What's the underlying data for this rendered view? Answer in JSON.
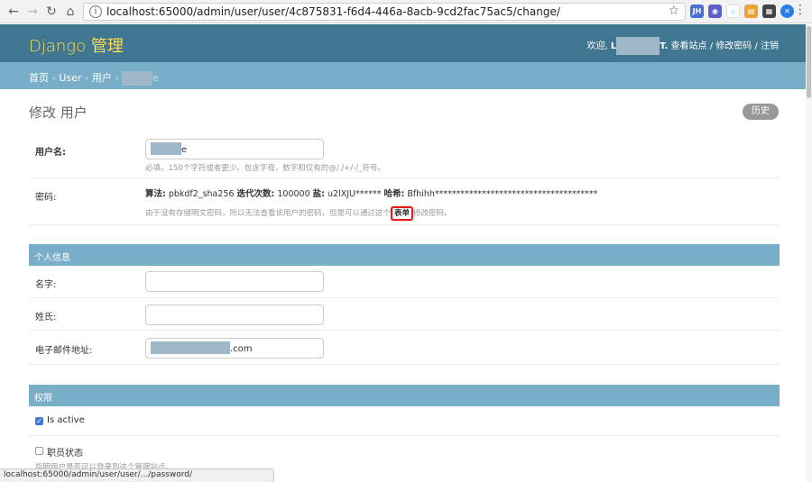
{
  "browser": {
    "url": "localhost:65000/admin/user/user/4c875831-f6d4-446a-8acb-9cd2fac75ac5/change/",
    "status_url": "localhost:65000/admin/user/user/.../password/",
    "extensions": [
      {
        "name": "JH",
        "color": "#4a6fd1"
      },
      {
        "name": "ext-2",
        "color": "#5b5fc7"
      },
      {
        "name": "react-icon",
        "color": "#ffffff"
      },
      {
        "name": "ext-4",
        "color": "#e8a33b"
      },
      {
        "name": "ext-5",
        "color": "#3aa35e"
      },
      {
        "name": "ext-6",
        "color": "#444444"
      },
      {
        "name": "ext-7",
        "color": "#ff8a00"
      },
      {
        "name": "ext-8",
        "color": "#2b7de9"
      }
    ]
  },
  "header": {
    "site_name": "Django 管理",
    "welcome": "欢迎,",
    "user_initial": "L",
    "user_suffix": "T.",
    "view_site": "查看站点",
    "change_password": "修改密码",
    "logout": "注销",
    "sep": " / "
  },
  "breadcrumbs": {
    "home": "首页",
    "app": "User",
    "model": "用户",
    "current_suffix": "e",
    "sep": " › "
  },
  "page": {
    "title": "修改 用户",
    "history_button": "历史"
  },
  "fields": {
    "username": {
      "label": "用户名:",
      "value_suffix": "e",
      "help": "必填。150个字符或者更少。包含字母，数字和仅有的@/./+/-/_符号。"
    },
    "password": {
      "label": "密码:",
      "algo_label": "算法:",
      "algo_value": "pbkdf2_sha256",
      "iter_label": "迭代次数:",
      "iter_value": "100000",
      "salt_label": "盐:",
      "salt_value": "u2lXJU******",
      "hash_label": "哈希:",
      "hash_value": "Bfhihh**************************************",
      "help_before": "由于没有存储明文密码，所以无法查看该用户的密码，但是可以通过这个",
      "help_link": "表单",
      "help_after": "修改密码。"
    }
  },
  "personal": {
    "caption": "个人信息",
    "first_name_label": "名字:",
    "last_name_label": "姓氏:",
    "email_label": "电子邮件地址:",
    "email_suffix": ".com"
  },
  "permissions": {
    "caption": "权限",
    "is_active_label": "Is active",
    "is_active": true,
    "is_staff_label": "职员状态",
    "is_staff": false,
    "is_staff_help": "指明用户是否可以登录到这个管理站点。"
  }
}
